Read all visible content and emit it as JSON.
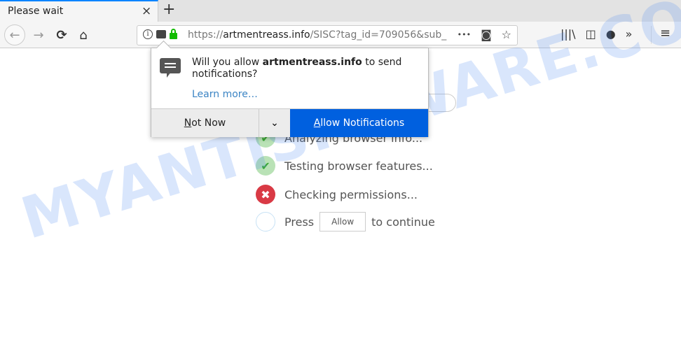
{
  "tab": {
    "title": "Please wait",
    "close": "×",
    "new_tab": "+"
  },
  "nav": {
    "back": "←",
    "forward": "→",
    "reload": "⟳",
    "home": "⌂"
  },
  "url": {
    "scheme": "https://",
    "host": "artmentreass.info",
    "path": "/SISC?tag_id=709056&sub_",
    "more": "•••",
    "pocket": "◙",
    "star": "☆"
  },
  "toolbar": {
    "library": "|||\\",
    "sidebar": "◫",
    "account": "●",
    "overflow": "»",
    "menu": "≡"
  },
  "popup": {
    "message_prefix": "Will you allow ",
    "message_host": "artmentreass.info",
    "message_suffix": " to send notifications?",
    "learn_more": "Learn more…",
    "not_now_key": "N",
    "not_now_rest": "ot Now",
    "dropdown": "⌄",
    "allow_key": "A",
    "allow_rest": "llow Notifications"
  },
  "steps": [
    {
      "status": "done",
      "icon": "✔",
      "text": "Analyzing browser info..."
    },
    {
      "status": "done",
      "icon": "✔",
      "text": "Testing browser features..."
    },
    {
      "status": "failed",
      "icon": "✖",
      "text": "Checking permissions..."
    },
    {
      "status": "pending",
      "prefix": "Press",
      "button": "Allow",
      "suffix": "to continue"
    }
  ],
  "watermark": "MYANTISPYWARE.COM",
  "colors": {
    "accent": "#0060df",
    "link": "#3b84c4",
    "ok": "#3aa835",
    "error": "#d93a45"
  }
}
